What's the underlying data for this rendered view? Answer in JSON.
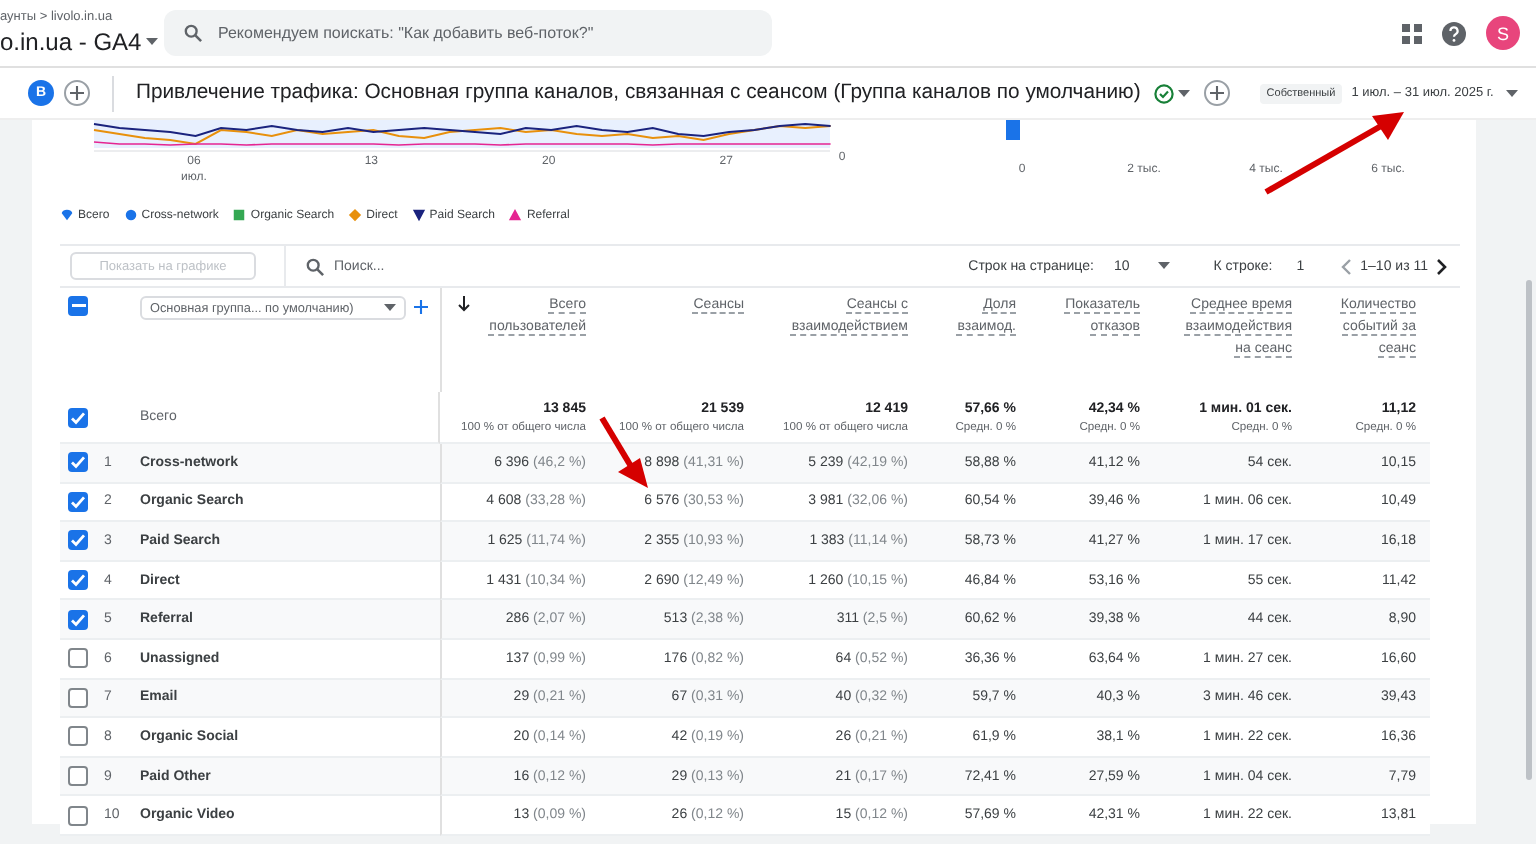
{
  "header": {
    "breadcrumb": "аунты > livolo.in.ua",
    "property": "o.in.ua - GA4",
    "search": {
      "placeholder": "Рекомендуем поискать: \"Как добавить веб-поток?\""
    },
    "avatar": "S"
  },
  "report": {
    "segment": "B",
    "title": "Привлечение трафика: Основная группа каналов, связанная с сеансом (Группа каналов по умолчанию)",
    "chip": "Собственный",
    "date_range": "1 июл. – 31 июл. 2025 г."
  },
  "line_chart": {
    "x_labels": [
      "06",
      "13",
      "20",
      "27"
    ],
    "x_sublabel": "июл.",
    "y_label": "0"
  },
  "bar_chart": {
    "x_labels": [
      "0",
      "2 тыс.",
      "4 тыс.",
      "6 тыс."
    ]
  },
  "legend": [
    {
      "label": "Всего",
      "kind": "drop",
      "color": "#1a73e8"
    },
    {
      "label": "Cross-network",
      "kind": "circle",
      "color": "#1a73e8"
    },
    {
      "label": "Organic Search",
      "kind": "square",
      "color": "#34a853"
    },
    {
      "label": "Direct",
      "kind": "diamond",
      "color": "#e8900c"
    },
    {
      "label": "Paid Search",
      "kind": "triangle_down",
      "color": "#1a237e"
    },
    {
      "label": "Referral",
      "kind": "triangle_up",
      "color": "#e52592"
    }
  ],
  "toolbar": {
    "plot_button": {
      "label": "Показать на графике",
      "disabled": true
    },
    "search": {
      "placeholder": "Поиск..."
    },
    "rows_label": "Строк на странице:",
    "rows_value": "10",
    "goto_label": "К строке:",
    "goto_value": "1",
    "range": "1–10 из 11"
  },
  "table": {
    "header_partial": true,
    "dimension": "Основная группа... по умолчанию)",
    "columns": [
      {
        "lines": [
          "Всего",
          "пользователей"
        ],
        "sorted": true
      },
      {
        "lines": [
          "Сеансы"
        ],
        "sorted": false
      },
      {
        "lines": [
          "Сеансы с",
          "взаимодействием"
        ],
        "sorted": false
      },
      {
        "lines": [
          "Доля",
          "взаимод."
        ],
        "sorted": false
      },
      {
        "lines": [
          "Показатель",
          "отказов"
        ],
        "sorted": false
      },
      {
        "lines": [
          "Среднее время",
          "взаимодействия",
          "на сеанс"
        ],
        "sorted": false
      },
      {
        "lines": [
          "Количество",
          "событий за",
          "сеанс"
        ],
        "sorted": false
      }
    ],
    "total": {
      "checked": true,
      "label": "Всего",
      "cells": [
        {
          "value": "13 845",
          "note": "100 % от общего числа"
        },
        {
          "value": "21 539",
          "note": "100 % от общего числа"
        },
        {
          "value": "12 419",
          "note": "100 % от общего числа"
        },
        {
          "value": "57,66 %",
          "note": "Средн. 0 %"
        },
        {
          "value": "42,34 %",
          "note": "Средн. 0 %"
        },
        {
          "value": "1 мин. 01 сек.",
          "note": "Средн. 0 %"
        },
        {
          "value": "11,12",
          "note": "Средн. 0 %"
        }
      ]
    },
    "rows": [
      {
        "checked": true,
        "index": "1",
        "name": "Cross-network",
        "cells": [
          {
            "value": "6 396",
            "share": "(46,2 %)"
          },
          {
            "value": "8 898",
            "share": "(41,31 %)"
          },
          {
            "value": "5 239",
            "share": "(42,19 %)"
          },
          {
            "value": "58,88 %"
          },
          {
            "value": "41,12 %"
          },
          {
            "value": "54 сек."
          },
          {
            "value": "10,15"
          }
        ]
      },
      {
        "checked": true,
        "index": "2",
        "name": "Organic Search",
        "cells": [
          {
            "value": "4 608",
            "share": "(33,28 %)"
          },
          {
            "value": "6 576",
            "share": "(30,53 %)"
          },
          {
            "value": "3 981",
            "share": "(32,06 %)"
          },
          {
            "value": "60,54 %"
          },
          {
            "value": "39,46 %"
          },
          {
            "value": "1 мин. 06 сек."
          },
          {
            "value": "10,49"
          }
        ]
      },
      {
        "checked": true,
        "index": "3",
        "name": "Paid Search",
        "cells": [
          {
            "value": "1 625",
            "share": "(11,74 %)"
          },
          {
            "value": "2 355",
            "share": "(10,93 %)"
          },
          {
            "value": "1 383",
            "share": "(11,14 %)"
          },
          {
            "value": "58,73 %"
          },
          {
            "value": "41,27 %"
          },
          {
            "value": "1 мин. 17 сек."
          },
          {
            "value": "16,18"
          }
        ]
      },
      {
        "checked": true,
        "index": "4",
        "name": "Direct",
        "cells": [
          {
            "value": "1 431",
            "share": "(10,34 %)"
          },
          {
            "value": "2 690",
            "share": "(12,49 %)"
          },
          {
            "value": "1 260",
            "share": "(10,15 %)"
          },
          {
            "value": "46,84 %"
          },
          {
            "value": "53,16 %"
          },
          {
            "value": "55 сек."
          },
          {
            "value": "11,42"
          }
        ]
      },
      {
        "checked": true,
        "index": "5",
        "name": "Referral",
        "cells": [
          {
            "value": "286",
            "share": "(2,07 %)"
          },
          {
            "value": "513",
            "share": "(2,38 %)"
          },
          {
            "value": "311",
            "share": "(2,5 %)"
          },
          {
            "value": "60,62 %"
          },
          {
            "value": "39,38 %"
          },
          {
            "value": "44 сек."
          },
          {
            "value": "8,90"
          }
        ]
      },
      {
        "checked": false,
        "index": "6",
        "name": "Unassigned",
        "cells": [
          {
            "value": "137",
            "share": "(0,99 %)"
          },
          {
            "value": "176",
            "share": "(0,82 %)"
          },
          {
            "value": "64",
            "share": "(0,52 %)"
          },
          {
            "value": "36,36 %"
          },
          {
            "value": "63,64 %"
          },
          {
            "value": "1 мин. 27 сек."
          },
          {
            "value": "16,60"
          }
        ]
      },
      {
        "checked": false,
        "index": "7",
        "name": "Email",
        "cells": [
          {
            "value": "29",
            "share": "(0,21 %)"
          },
          {
            "value": "67",
            "share": "(0,31 %)"
          },
          {
            "value": "40",
            "share": "(0,32 %)"
          },
          {
            "value": "59,7 %"
          },
          {
            "value": "40,3 %"
          },
          {
            "value": "3 мин. 46 сек."
          },
          {
            "value": "39,43"
          }
        ]
      },
      {
        "checked": false,
        "index": "8",
        "name": "Organic Social",
        "cells": [
          {
            "value": "20",
            "share": "(0,14 %)"
          },
          {
            "value": "42",
            "share": "(0,19 %)"
          },
          {
            "value": "26",
            "share": "(0,21 %)"
          },
          {
            "value": "61,9 %"
          },
          {
            "value": "38,1 %"
          },
          {
            "value": "1 мин. 22 сек."
          },
          {
            "value": "16,36"
          }
        ]
      },
      {
        "checked": false,
        "index": "9",
        "name": "Paid Other",
        "cells": [
          {
            "value": "16",
            "share": "(0,12 %)"
          },
          {
            "value": "29",
            "share": "(0,13 %)"
          },
          {
            "value": "21",
            "share": "(0,17 %)"
          },
          {
            "value": "72,41 %"
          },
          {
            "value": "27,59 %"
          },
          {
            "value": "1 мин. 04 сек."
          },
          {
            "value": "7,79"
          }
        ]
      },
      {
        "checked": false,
        "index": "10",
        "name": "Organic Video",
        "cells": [
          {
            "value": "13",
            "share": "(0,09 %)"
          },
          {
            "value": "26",
            "share": "(0,12 %)"
          },
          {
            "value": "15",
            "share": "(0,12 %)"
          },
          {
            "value": "57,69 %"
          },
          {
            "value": "42,31 %"
          },
          {
            "value": "1 мин. 22 сек."
          },
          {
            "value": "13,81"
          }
        ]
      }
    ]
  }
}
